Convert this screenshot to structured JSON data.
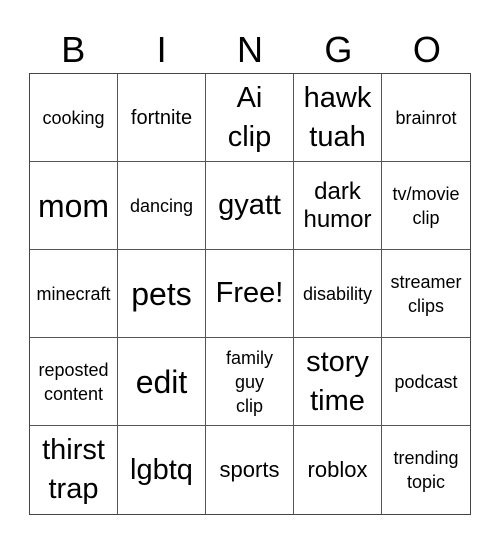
{
  "title_letters": [
    "B",
    "I",
    "N",
    "G",
    "O"
  ],
  "cells": [
    {
      "text": "cooking",
      "size": "s18"
    },
    {
      "text": "fortnite",
      "size": "s20"
    },
    {
      "text": "Ai\nclip",
      "size": "s28"
    },
    {
      "text": "hawk\ntuah",
      "size": "s28"
    },
    {
      "text": "brainrot",
      "size": "s18"
    },
    {
      "text": "mom",
      "size": "s32"
    },
    {
      "text": "dancing",
      "size": "s18"
    },
    {
      "text": "gyatt",
      "size": "s28"
    },
    {
      "text": "dark\nhumor",
      "size": "s24"
    },
    {
      "text": "tv/movie\nclip",
      "size": "s18"
    },
    {
      "text": "minecraft",
      "size": "s18"
    },
    {
      "text": "pets",
      "size": "s32"
    },
    {
      "text": "Free!",
      "size": "s28"
    },
    {
      "text": "disability",
      "size": "s18"
    },
    {
      "text": "streamer\nclips",
      "size": "s18"
    },
    {
      "text": "reposted\ncontent",
      "size": "s18"
    },
    {
      "text": "edit",
      "size": "s32"
    },
    {
      "text": "family\nguy\nclip",
      "size": "s18"
    },
    {
      "text": "story\ntime",
      "size": "s28"
    },
    {
      "text": "podcast",
      "size": "s18"
    },
    {
      "text": "thirst\ntrap",
      "size": "s28"
    },
    {
      "text": "lgbtq",
      "size": "s28"
    },
    {
      "text": "sports",
      "size": "s22"
    },
    {
      "text": "roblox",
      "size": "s22"
    },
    {
      "text": "trending\ntopic",
      "size": "s18"
    }
  ]
}
